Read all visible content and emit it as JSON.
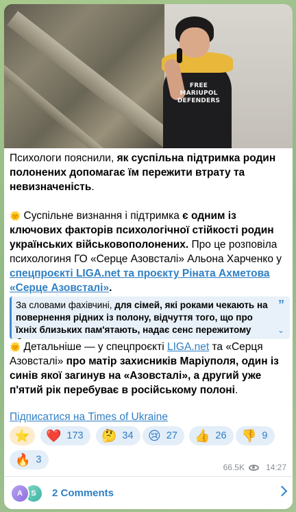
{
  "photo": {
    "shirt_text": "FREE\nMARIUPOL\nDEFENDERS"
  },
  "post": {
    "p1_pre": "Психологи пояснили, ",
    "p1_bold": "як суспільна підтримка родин полонених допомагає їм пережити втрату та невизначеність",
    "p1_post": ".",
    "p2_icon": "sun-emoji",
    "p2_pre": " Суспільне визнання і підтримка ",
    "p2_bold": "є одним із ключових факторів психологічної стійкості родин українських військовополонених.",
    "p2_mid": " Про це розповіла психологиня ГО «Серце Азовсталі» Альона Харченко у ",
    "p2_link": "спецпроєкті LIGA.net та проєкту Ріната Ахметова «Серце Азовсталі»",
    "p2_end": ".",
    "quote_pre": "За словами фахівчині, ",
    "quote_bold": "для сімей, які роками чекають на повернення рідних із полону, відчуття того, що про їхніх близьких пам'ятають, надає сенс пережитому болю та",
    "p3_icon": "sun-emoji",
    "p3_pre": " Детальніше — у спецпроєкті ",
    "p3_link": "LIGA.net",
    "p3_mid": " та «Серця Азовсталі» ",
    "p3_bold": "про матір захисників Маріуполя, один із синів якої загинув на «Азовсталі», а другий уже п'ятий рік перебуває в російському полоні",
    "p3_end": ".",
    "subscribe_link": "Підписатися на Times of Ukraine"
  },
  "reactions": [
    {
      "emoji": "⭐",
      "count": ""
    },
    {
      "emoji": "❤️",
      "count": "173"
    },
    {
      "emoji": "🤔",
      "count": "34"
    },
    {
      "emoji": "😢",
      "count": "27"
    },
    {
      "emoji": "👍",
      "count": "26"
    },
    {
      "emoji": "👎",
      "count": "9"
    },
    {
      "emoji": "🔥",
      "count": "3"
    }
  ],
  "meta": {
    "views": "66.5K",
    "time": "14:27"
  },
  "comments": {
    "avatar1": "A",
    "avatar2": "S",
    "label": "2 Comments"
  },
  "colors": {
    "link": "#2f7fc4",
    "quote_bg": "#e8f1f9",
    "reaction_bg": "#e3eef8"
  }
}
